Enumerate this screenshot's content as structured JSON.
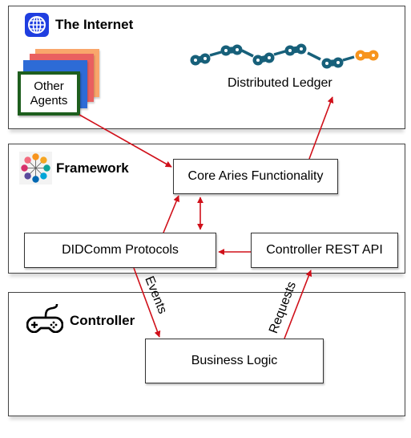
{
  "internet": {
    "title": "The Internet",
    "icon": "globe-icon",
    "other_agents": {
      "line1": "Other",
      "line2": "Agents"
    },
    "agent_stack_colors": [
      "#f9a66b",
      "#e96060",
      "#2d6bd6"
    ],
    "ledger": {
      "label": "Distributed Ledger",
      "chain_color": "#17607a",
      "accent_color": "#f7941d"
    }
  },
  "framework": {
    "title": "Framework",
    "icon": "hyperledger-aries-icon",
    "core": "Core Aries Functionality",
    "didcomm": "DIDComm Protocols",
    "rest_api": "Controller REST API"
  },
  "controller": {
    "title": "Controller",
    "icon": "gamepad-icon",
    "business_logic": "Business Logic"
  },
  "edges": {
    "events_label": "Events",
    "requests_label": "Requests",
    "arrow_color": "#d0101a"
  }
}
